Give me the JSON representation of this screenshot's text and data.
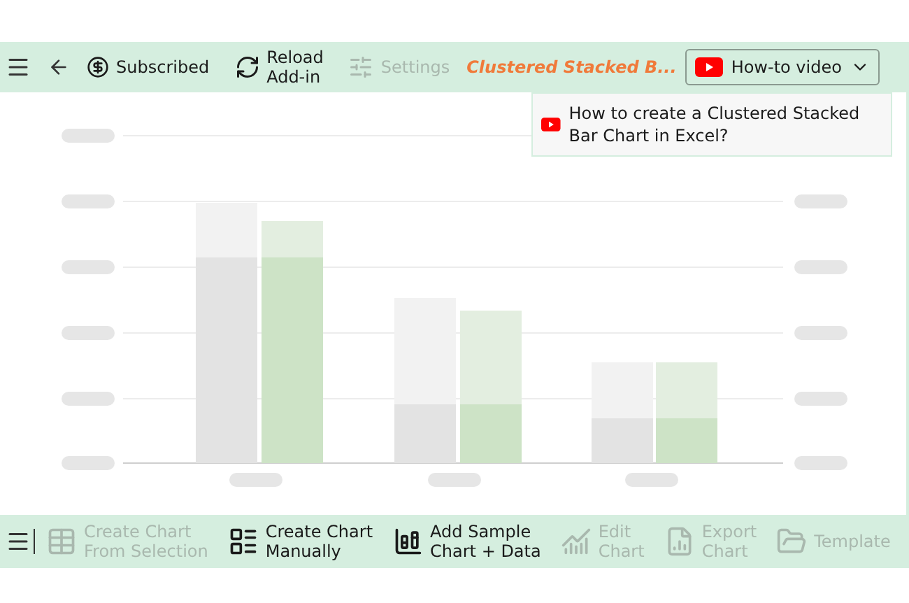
{
  "top_toolbar": {
    "items": [
      {
        "kind": "subscribed",
        "label": "Subscribed",
        "disabled": false
      },
      {
        "kind": "reload",
        "label": "Reload\nAdd-in",
        "disabled": false
      },
      {
        "kind": "settings",
        "label": "Settings",
        "disabled": true
      }
    ],
    "chart_title": "Clustered Stacked B...",
    "video_dropdown": {
      "label": "How-to video"
    }
  },
  "video_menu": {
    "items": [
      {
        "label": "How to create a Clustered Stacked Bar Chart in Excel?"
      }
    ]
  },
  "bottom_toolbar": {
    "items": [
      {
        "kind": "from_selection",
        "label": "Create Chart\nFrom Selection",
        "disabled": true
      },
      {
        "kind": "manual",
        "label": "Create Chart\nManually",
        "disabled": false
      },
      {
        "kind": "sample",
        "label": "Add Sample\nChart + Data",
        "disabled": false
      },
      {
        "kind": "edit",
        "label": "Edit\nChart",
        "disabled": true
      },
      {
        "kind": "export",
        "label": "Export\nChart",
        "disabled": true
      },
      {
        "kind": "template",
        "label": "Template",
        "disabled": true
      }
    ]
  }
}
